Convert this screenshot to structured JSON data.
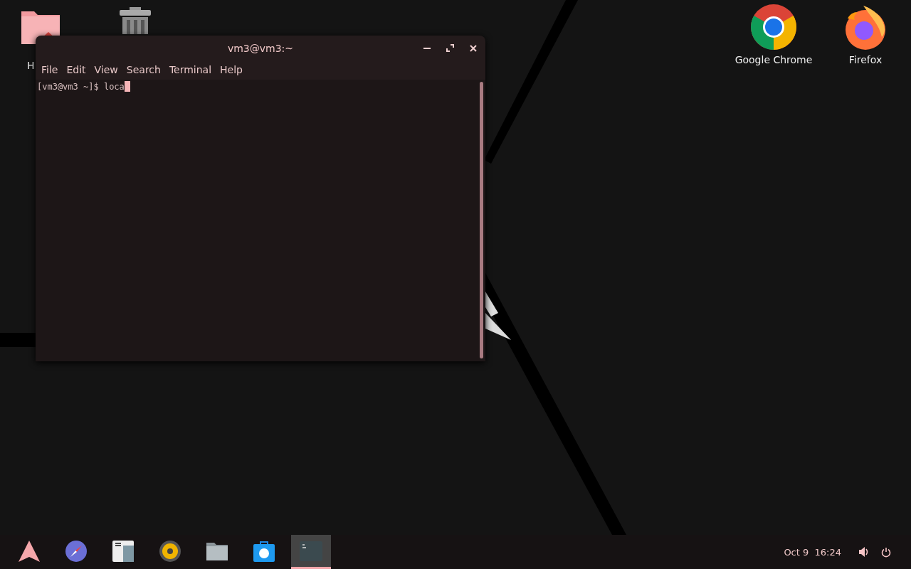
{
  "desktop_icons": [
    {
      "kind": "home",
      "label": "H"
    },
    {
      "kind": "trash"
    },
    {
      "kind": "chrome",
      "label": "Google Chrome"
    },
    {
      "kind": "firefox",
      "label": "Firefox"
    }
  ],
  "terminal_window": {
    "title": "vm3@vm3:~",
    "menu": [
      "File",
      "Edit",
      "View",
      "Search",
      "Terminal",
      "Help"
    ],
    "prompt": "[vm3@vm3 ~]$ ",
    "input": "loca"
  },
  "taskbar": {
    "items": [
      {
        "kind": "arch",
        "selected": false
      },
      {
        "kind": "compass",
        "selected": false
      },
      {
        "kind": "calendar",
        "selected": false
      },
      {
        "kind": "speaker",
        "selected": false
      },
      {
        "kind": "folder",
        "selected": false
      },
      {
        "kind": "store",
        "selected": false
      },
      {
        "kind": "terminal",
        "selected": true
      }
    ],
    "clock": "Oct 9  16:24"
  }
}
